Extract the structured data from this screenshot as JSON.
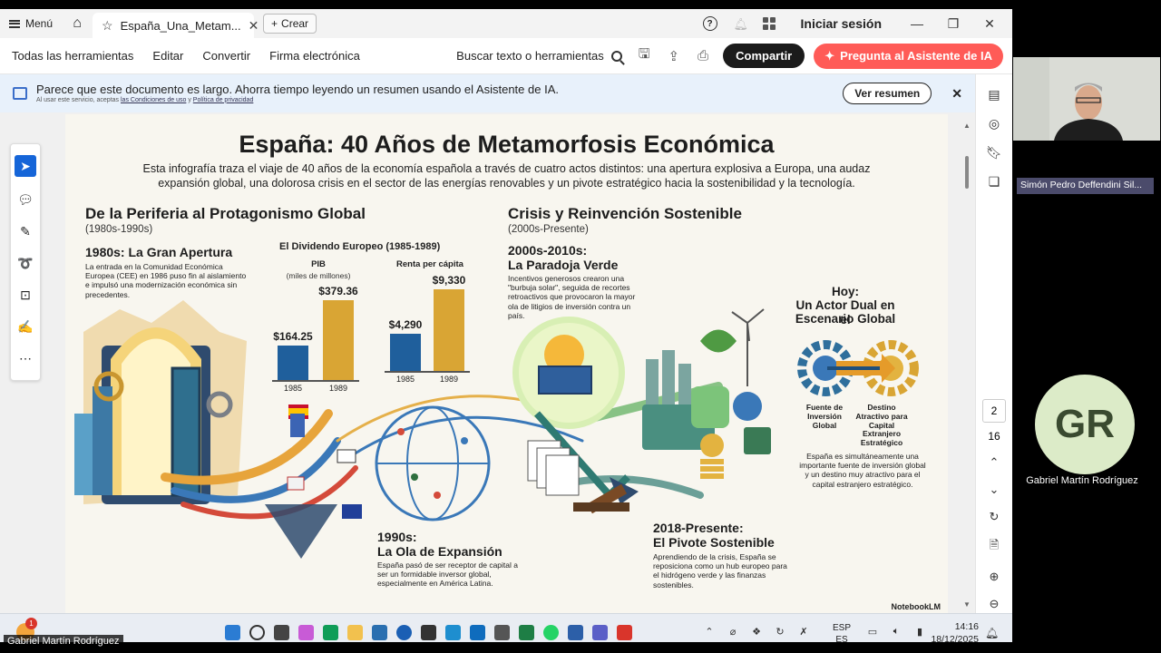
{
  "titlebar": {
    "menu_label": "Menú",
    "tab_title": "España_Una_Metam...",
    "new_tab_label": "Crear",
    "sign_in": "Iniciar sesión"
  },
  "toolbar": {
    "tools": [
      "Todas las herramientas",
      "Editar",
      "Convertir",
      "Firma electrónica"
    ],
    "search_label": "Buscar texto o herramientas",
    "share_label": "Compartir",
    "ai_label": "Pregunta al Asistente de IA"
  },
  "banner": {
    "text": "Parece que este documento es largo. Ahorra tiempo leyendo un resumen usando el Asistente de IA.",
    "fine_prefix": "Al usar este servicio, aceptas",
    "fine_link1": "las Condiciones de uso",
    "fine_mid": "y",
    "fine_link2": "Política de privacidad",
    "summary_button": "Ver resumen"
  },
  "pager": {
    "current": "2",
    "total": "16"
  },
  "document": {
    "title": "España: 40 Años de Metamorfosis Económica",
    "intro": "Esta infografía traza el viaje de 40 años de la economía española a través de cuatro actos distintos: una apertura explosiva a Europa, una audaz expansión global, una dolorosa crisis en el sector de las energías renovables y un pivote estratégico hacia la sostenibilidad y la tecnología.",
    "left_section": {
      "title": "De la Periferia al Protagonismo Global",
      "subtitle": "(1980s-1990s)"
    },
    "right_section": {
      "title": "Crisis y Reinvención Sostenible",
      "subtitle": "(2000s-Presente)"
    },
    "block_1980s": {
      "title": "1980s: La Gran Apertura",
      "text": "La entrada en la Comunidad Económica Europea (CEE) en 1986 puso fin al aislamiento e impulsó una modernización económica sin precedentes."
    },
    "block_2000s": {
      "title_line1": "2000s-2010s:",
      "title_line2": "La Paradoja Verde",
      "text": "Incentivos generosos crearon una \"burbuja solar\", seguida de recortes retroactivos que provocaron la mayor ola de litigios de inversión contra un país."
    },
    "block_hoy": {
      "title_line1": "Hoy:",
      "title_line2": "Un Actor Dual en el",
      "title_line3": "Escenario Global",
      "label_left": "Fuente de Inversión Global",
      "label_right": "Destino Atractivo para Capital Extranjero Estratégico",
      "text": "España es simultáneamente una importante fuente de inversión global y un destino muy atractivo para el capital estranjero estratégico."
    },
    "block_1990s": {
      "title_line1": "1990s:",
      "title_line2": "La Ola de Expansión",
      "text": "España pasó de ser receptor de capital a ser un formidable inversor global, especialmente en América Latina."
    },
    "block_2018": {
      "title_line1": "2018-Presente:",
      "title_line2": "El Pivote Sostenible",
      "text": "Aprendiendo de la crisis, España se reposiciona como un hub europeo para el hidrógeno verde y las finanzas sostenibles."
    },
    "watermark": "NotebookLM"
  },
  "chart_data": [
    {
      "type": "bar",
      "title": "El Dividendo Europeo (1985-1989)",
      "subtitle": "PIB",
      "unit_label": "(miles de millones)",
      "categories": [
        "1985",
        "1989"
      ],
      "values": [
        164.25,
        379.36
      ],
      "value_labels": [
        "$164.25",
        "$379.36"
      ],
      "colors": [
        "#1f5f9c",
        "#d9a534"
      ]
    },
    {
      "type": "bar",
      "subtitle": "Renta per cápita",
      "categories": [
        "1985",
        "1989"
      ],
      "values": [
        4290,
        9330
      ],
      "value_labels": [
        "$4,290",
        "$9,330"
      ],
      "colors": [
        "#1f5f9c",
        "#d9a534"
      ]
    }
  ],
  "taskbar": {
    "badge": "1",
    "lang_line1": "ESP",
    "lang_line2": "ES",
    "time": "14:16",
    "date": "18/12/2025"
  },
  "meeting": {
    "self_label": "Gabriel Martín Rodríguez",
    "cam_participant": "Simón Pedro Deffendini Sil...",
    "avatar_initials": "GR",
    "avatar_name": "Gabriel Martín Rodríguez"
  }
}
